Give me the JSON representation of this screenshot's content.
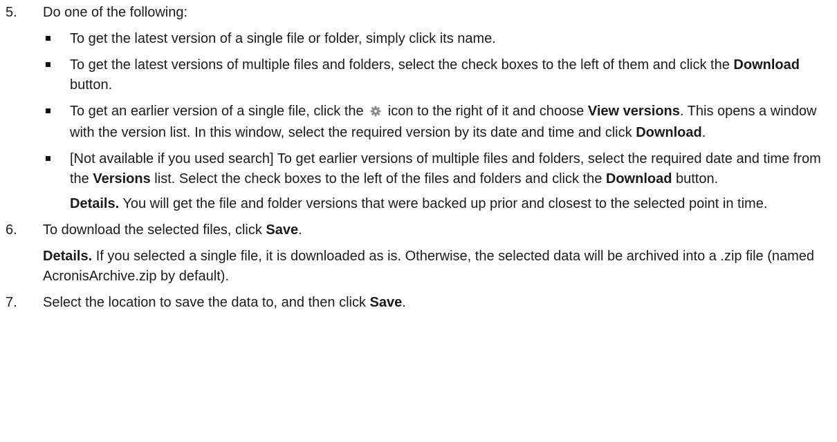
{
  "steps": [
    {
      "num": "5.",
      "intro": "Do one of the following:",
      "bullets": [
        {
          "t1": "To get the latest version of a single file or folder, simply click its name."
        },
        {
          "t1": "To get the latest versions of multiple files and folders, select the check boxes to the left of them and click the ",
          "b1": "Download",
          "t2": " button."
        },
        {
          "t1": "To get an earlier version of a single file, click the ",
          "icon": "gear-icon",
          "t2": " icon to the right of it and choose ",
          "b1": "View versions",
          "t3": ". This opens a window with the version list. In this window, select the required version by its date and time and click ",
          "b2": "Download",
          "t4": "."
        },
        {
          "t1": "[Not available if you used search] To get earlier versions of multiple files and folders, select the required date and time from the ",
          "b1": "Versions",
          "t2": " list. Select the check boxes to the left of the files and folders and click the ",
          "b2": "Download",
          "t3": " button."
        }
      ],
      "details_label": "Details.",
      "details_text": " You will get the file and folder versions that were backed up prior and closest to the selected point in time."
    },
    {
      "num": "6.",
      "t1": "To download the selected files, click ",
      "b1": "Save",
      "t2": ".",
      "details_label": "Details.",
      "details_text": " If you selected a single file, it is downloaded as is. Otherwise, the selected data will be archived into a .zip file (named AcronisArchive.zip by default)."
    },
    {
      "num": "7.",
      "t1": "Select the location to save the data to, and then click ",
      "b1": "Save",
      "t2": "."
    }
  ],
  "colors": {
    "text": "#1a1a1a",
    "icon": "#8a8a8a"
  }
}
